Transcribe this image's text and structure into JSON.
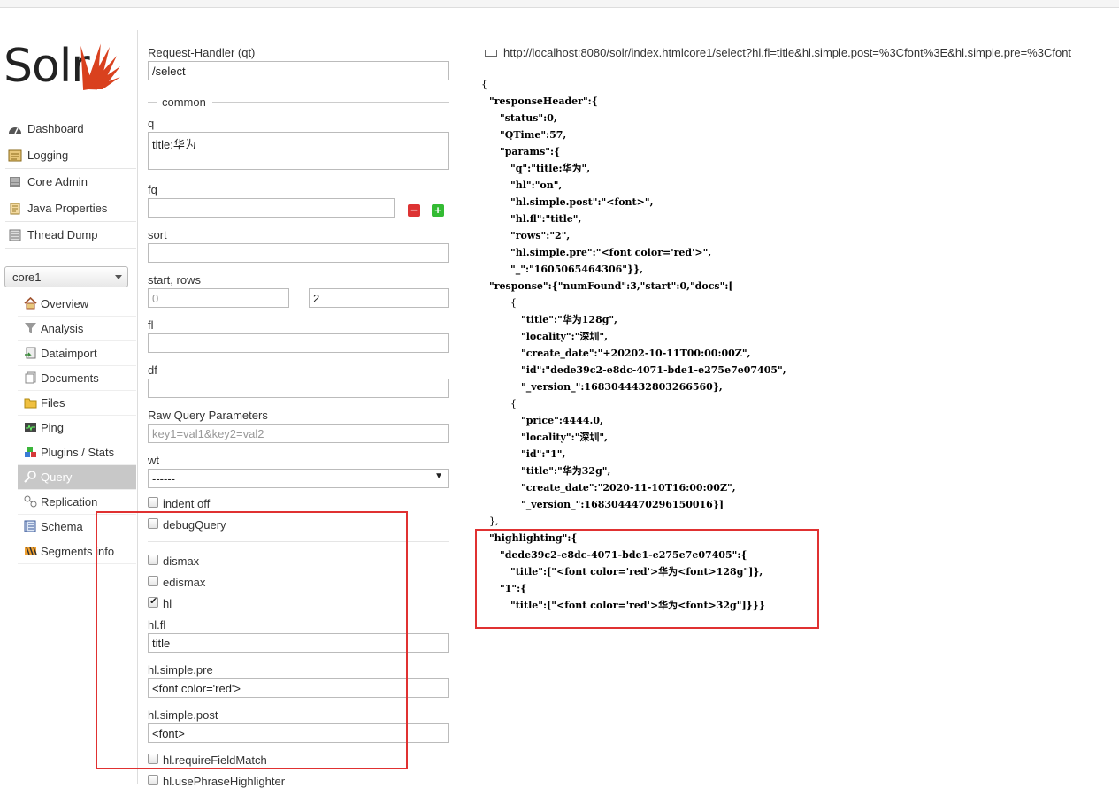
{
  "bookmarks": [],
  "sidebar": {
    "logo_text": "Solr",
    "nav": [
      {
        "label": "Dashboard",
        "icon": "dashboard-icon"
      },
      {
        "label": "Logging",
        "icon": "logging-icon"
      },
      {
        "label": "Core Admin",
        "icon": "core-admin-icon"
      },
      {
        "label": "Java Properties",
        "icon": "java-properties-icon"
      },
      {
        "label": "Thread Dump",
        "icon": "thread-dump-icon"
      }
    ],
    "core_selector": "core1",
    "core_menu": [
      {
        "label": "Overview",
        "icon": "overview-icon"
      },
      {
        "label": "Analysis",
        "icon": "analysis-icon"
      },
      {
        "label": "Dataimport",
        "icon": "dataimport-icon"
      },
      {
        "label": "Documents",
        "icon": "documents-icon"
      },
      {
        "label": "Files",
        "icon": "files-icon"
      },
      {
        "label": "Ping",
        "icon": "ping-icon"
      },
      {
        "label": "Plugins / Stats",
        "icon": "plugins-icon"
      },
      {
        "label": "Query",
        "icon": "query-icon",
        "active": true
      },
      {
        "label": "Replication",
        "icon": "replication-icon"
      },
      {
        "label": "Schema",
        "icon": "schema-icon"
      },
      {
        "label": "Segments info",
        "icon": "segments-icon"
      }
    ]
  },
  "form": {
    "request_handler_label": "Request-Handler (qt)",
    "request_handler_value": "/select",
    "common_legend": "common",
    "q_label": "q",
    "q_value": "title:华为",
    "fq_label": "fq",
    "fq_value": "",
    "sort_label": "sort",
    "sort_value": "",
    "start_rows_label": "start, rows",
    "start_value": "0",
    "rows_value": "2",
    "fl_label": "fl",
    "fl_value": "",
    "df_label": "df",
    "df_value": "",
    "raw_label": "Raw Query Parameters",
    "raw_placeholder": "key1=val1&key2=val2",
    "wt_label": "wt",
    "wt_value": "------",
    "indent_label": "indent off",
    "debug_label": "debugQuery",
    "dismax_label": "dismax",
    "edismax_label": "edismax",
    "hl_label": "hl",
    "hl_checked": true,
    "hl_fl_label": "hl.fl",
    "hl_fl_value": "title",
    "hl_pre_label": "hl.simple.pre",
    "hl_pre_value": "<font color='red'>",
    "hl_post_label": "hl.simple.post",
    "hl_post_value": "<font>",
    "require_field_match_label": "hl.requireFieldMatch",
    "use_phrase_label": "hl.usePhraseHighlighter"
  },
  "results": {
    "url": "http://localhost:8080/solr/index.htmlcore1/select?hl.fl=title&hl.simple.post=%3Cfont%3E&hl.simple.pre=%3Cfont",
    "json_lines": [
      "{",
      "\"responseHeader\":{",
      "\"status\":0,",
      "\"QTime\":57,",
      "\"params\":{",
      "\"q\":\"title:华为\",",
      "\"hl\":\"on\",",
      "\"hl.simple.post\":\"<font>\",",
      "\"hl.fl\":\"title\",",
      "\"rows\":\"2\",",
      "\"hl.simple.pre\":\"<font color='red'>\",",
      "\"_\":\"1605065464306\"}},",
      "\"response\":{\"numFound\":3,\"start\":0,\"docs\":[",
      "{",
      "\"title\":\"华为128g\",",
      "\"locality\":\"深圳\",",
      "\"create_date\":\"+20202-10-11T00:00:00Z\",",
      "\"id\":\"dede39c2-e8dc-4071-bde1-e275e7e07405\",",
      "\"_version_\":1683044432803266560},",
      "{",
      "\"price\":4444.0,",
      "\"locality\":\"深圳\",",
      "\"id\":\"1\",",
      "\"title\":\"华为32g\",",
      "\"create_date\":\"2020-11-10T16:00:00Z\",",
      "\"_version_\":1683044470296150016}]",
      "},",
      "\"highlighting\":{",
      "\"dede39c2-e8dc-4071-bde1-e275e7e07405\":{",
      "\"title\":[\"<font color='red'>华为<font>128g\"]},",
      "\"1\":{",
      "\"title\":[\"<font color='red'>华为<font>32g\"]}}}"
    ]
  },
  "colors": {
    "highlight_box": "#e03131",
    "logo_accent": "#d9411e"
  }
}
